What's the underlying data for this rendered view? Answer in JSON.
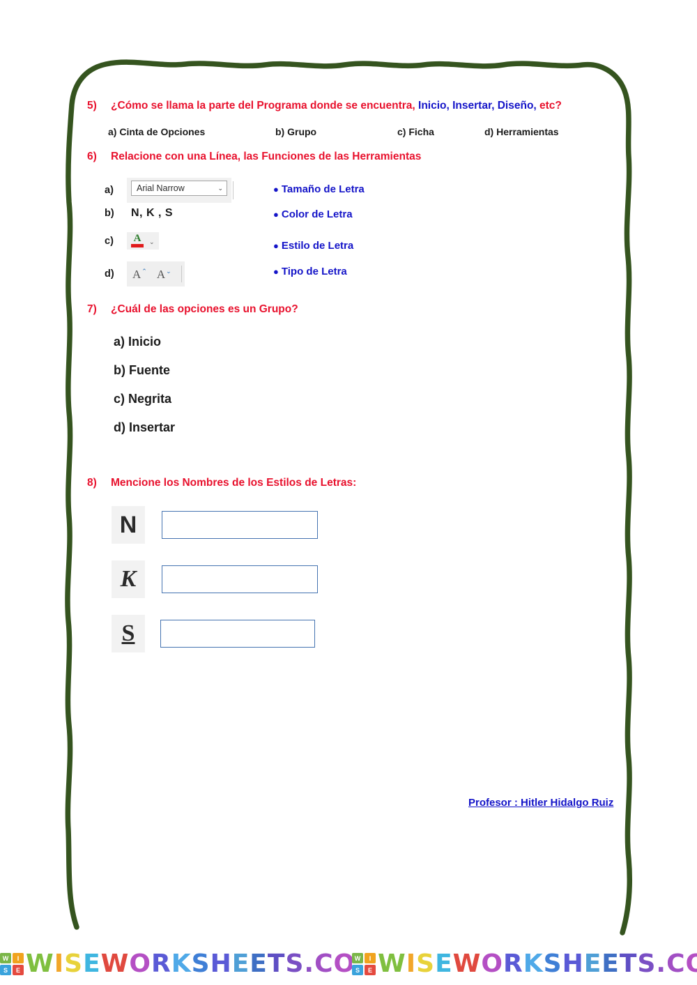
{
  "document": {
    "type": "worksheet",
    "language": "es",
    "border_color": "#35541f",
    "heading_color": "#e8112d",
    "accent_blue": "#1414c8"
  },
  "questions": [
    {
      "number": "5)",
      "prompt_part1": "¿Cómo se llama la parte del Programa donde se encuentra,",
      "prompt_highlight": " Inicio, Insertar, Diseño,",
      "prompt_part2": " etc?",
      "options": [
        "a) Cinta de Opciones",
        "b) Grupo",
        "c) Ficha",
        "d) Herramientas"
      ]
    },
    {
      "number": "6)",
      "prompt": "Relacione con una Línea, las Funciones de las Herramientas",
      "items": [
        {
          "label": "a)",
          "kind": "font-name-combo",
          "value": "Arial Narrow",
          "caret": "⌄"
        },
        {
          "label": "b)",
          "kind": "text",
          "value": "N, K , S"
        },
        {
          "label": "c)",
          "kind": "font-color-icon",
          "value": "A",
          "caret": "⌄"
        },
        {
          "label": "d)",
          "kind": "font-size-icons",
          "grow": "A",
          "grow_caret": "⌃",
          "shrink": "A",
          "shrink_caret": "⌄"
        }
      ],
      "answers": [
        "Tamaño de Letra",
        "Color de Letra",
        "Estilo de Letra",
        "Tipo de Letra"
      ],
      "bullet_glyph": "●"
    },
    {
      "number": "7)",
      "prompt": "¿Cuál de las opciones es un Grupo?",
      "options": [
        "a) Inicio",
        "b) Fuente",
        "c) Negrita",
        "d) Insertar"
      ]
    },
    {
      "number": "8)",
      "prompt": "Mencione los Nombres de los Estilos de Letras:",
      "style_rows": [
        {
          "glyph": "N",
          "style": "bold",
          "answer_value": ""
        },
        {
          "glyph": "K",
          "style": "italic",
          "answer_value": ""
        },
        {
          "glyph": "S",
          "style": "underline",
          "answer_value": ""
        }
      ]
    }
  ],
  "signature": "Profesor : Hitler Hidalgo Ruiz",
  "watermark": {
    "logo_letters": [
      "W",
      "I",
      "S",
      "E"
    ],
    "text": "WISEWORKSHEETS.COM",
    "repeat": 2
  }
}
